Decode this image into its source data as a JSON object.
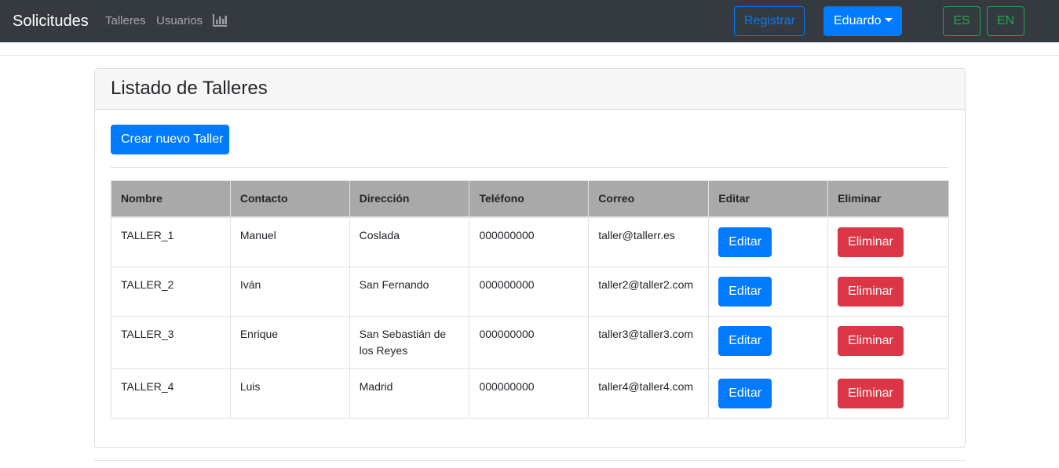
{
  "navbar": {
    "brand": "Solicitudes",
    "links": [
      "Talleres",
      "Usuarios"
    ],
    "chart_icon": "bar-chart-icon",
    "register_label": "Registrar",
    "user_label": "Eduardo",
    "lang_es": "ES",
    "lang_en": "EN"
  },
  "card": {
    "title": "Listado de Talleres",
    "create_button": "Crear nuevo Taller"
  },
  "table": {
    "headers": [
      "Nombre",
      "Contacto",
      "Dirección",
      "Teléfono",
      "Correo",
      "Editar",
      "Eliminar"
    ],
    "rows": [
      {
        "nombre": "TALLER_1",
        "contacto": "Manuel",
        "direccion": "Coslada",
        "telefono": "000000000",
        "correo": "taller@tallerr.es",
        "editar": "Editar",
        "eliminar": "Eliminar"
      },
      {
        "nombre": "TALLER_2",
        "contacto": "Iván",
        "direccion": "San Fernando",
        "telefono": "000000000",
        "correo": "taller2@taller2.com",
        "editar": "Editar",
        "eliminar": "Eliminar"
      },
      {
        "nombre": "TALLER_3",
        "contacto": "Enrique",
        "direccion": "San Sebastián de los Reyes",
        "telefono": "000000000",
        "correo": "taller3@taller3.com",
        "editar": "Editar",
        "eliminar": "Eliminar"
      },
      {
        "nombre": "TALLER_4",
        "contacto": "Luis",
        "direccion": "Madrid",
        "telefono": "000000000",
        "correo": "taller4@taller4.com",
        "editar": "Editar",
        "eliminar": "Eliminar"
      }
    ]
  },
  "colors": {
    "navbar_bg": "#343a40",
    "primary": "#007bff",
    "danger": "#dc3545",
    "success": "#28a745",
    "table_header_bg": "#a9a9a9"
  }
}
